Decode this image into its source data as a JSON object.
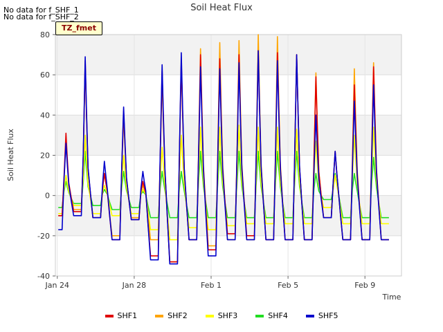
{
  "notes": [
    "No data for f_SHF_1",
    "No data for f_SHF_2"
  ],
  "tz_label": "TZ_fmet",
  "chart_data": {
    "type": "line",
    "title": "Soil Heat Flux",
    "xlabel": "Time",
    "ylabel": "Soil Heat Flux",
    "ylim": [
      -40,
      80
    ],
    "yticks": [
      -40,
      -20,
      0,
      20,
      40,
      60,
      80
    ],
    "xlim_days": [
      -0.1,
      17.9
    ],
    "xticks": [
      {
        "day": 0,
        "label": "Jan 24"
      },
      {
        "day": 4,
        "label": "Jan 28"
      },
      {
        "day": 8,
        "label": "Feb 1"
      },
      {
        "day": 12,
        "label": "Feb 5"
      },
      {
        "day": 16,
        "label": "Feb 9"
      }
    ],
    "grid": true,
    "legend_position": "bottom",
    "peaks_by_day": [
      {
        "day": 0,
        "SHF1": 31,
        "SHF2": 27,
        "SHF3": 10,
        "SHF4": 7,
        "SHF5": 26
      },
      {
        "day": 1,
        "SHF1": 67,
        "SHF2": 65,
        "SHF3": 30,
        "SHF4": 22,
        "SHF5": 69
      },
      {
        "day": 2,
        "SHF1": 11,
        "SHF2": 11,
        "SHF3": 5,
        "SHF4": 3,
        "SHF5": 17
      },
      {
        "day": 3,
        "SHF1": 42,
        "SHF2": 39,
        "SHF3": 20,
        "SHF4": 12,
        "SHF5": 44
      },
      {
        "day": 4,
        "SHF1": 7,
        "SHF2": 5,
        "SHF3": 3,
        "SHF4": 2,
        "SHF5": 12
      },
      {
        "day": 5,
        "SHF1": 62,
        "SHF2": 58,
        "SHF3": 24,
        "SHF4": 12,
        "SHF5": 65
      },
      {
        "day": 6,
        "SHF1": 67,
        "SHF2": 66,
        "SHF3": 30,
        "SHF4": 12,
        "SHF5": 71
      },
      {
        "day": 7,
        "SHF1": 70,
        "SHF2": 73,
        "SHF3": 34,
        "SHF4": 22,
        "SHF5": 64
      },
      {
        "day": 8,
        "SHF1": 68,
        "SHF2": 76,
        "SHF3": 34,
        "SHF4": 22,
        "SHF5": 63
      },
      {
        "day": 9,
        "SHF1": 70,
        "SHF2": 77,
        "SHF3": 35,
        "SHF4": 22,
        "SHF5": 66
      },
      {
        "day": 10,
        "SHF1": 72,
        "SHF2": 80,
        "SHF3": 34,
        "SHF4": 22,
        "SHF5": 72
      },
      {
        "day": 11,
        "SHF1": 71,
        "SHF2": 79,
        "SHF3": 34,
        "SHF4": 22,
        "SHF5": 67
      },
      {
        "day": 12,
        "SHF1": 70,
        "SHF2": 70,
        "SHF3": 33,
        "SHF4": 22,
        "SHF5": 70
      },
      {
        "day": 13,
        "SHF1": 59,
        "SHF2": 61,
        "SHF3": 27,
        "SHF4": 11,
        "SHF5": 40
      },
      {
        "day": 14,
        "SHF1": 22,
        "SHF2": 22,
        "SHF3": 10,
        "SHF4": 11,
        "SHF5": 22
      },
      {
        "day": 15,
        "SHF1": 55,
        "SHF2": 63,
        "SHF3": 30,
        "SHF4": 11,
        "SHF5": 47
      },
      {
        "day": 16,
        "SHF1": 64,
        "SHF2": 66,
        "SHF3": 34,
        "SHF4": 19,
        "SHF5": 55
      }
    ],
    "troughs_by_day": [
      {
        "day": 0,
        "SHF1": -10,
        "SHF2": -10,
        "SHF3": -9,
        "SHF4": -6,
        "SHF5": -17
      },
      {
        "day": 1,
        "SHF1": -8,
        "SHF2": -7,
        "SHF3": -5,
        "SHF4": -4,
        "SHF5": -10
      },
      {
        "day": 2,
        "SHF1": -11,
        "SHF2": -11,
        "SHF3": -9,
        "SHF4": -5,
        "SHF5": -11
      },
      {
        "day": 3,
        "SHF1": -22,
        "SHF2": -20,
        "SHF3": -10,
        "SHF4": -7,
        "SHF5": -22
      },
      {
        "day": 4,
        "SHF1": -12,
        "SHF2": -11,
        "SHF3": -9,
        "SHF4": -6,
        "SHF5": -12
      },
      {
        "day": 5,
        "SHF1": -30,
        "SHF2": -22,
        "SHF3": -17,
        "SHF4": -11,
        "SHF5": -32
      },
      {
        "day": 6,
        "SHF1": -33,
        "SHF2": -33,
        "SHF3": -22,
        "SHF4": -11,
        "SHF5": -34
      },
      {
        "day": 7,
        "SHF1": -22,
        "SHF2": -22,
        "SHF3": -16,
        "SHF4": -11,
        "SHF5": -22
      },
      {
        "day": 8,
        "SHF1": -27,
        "SHF2": -25,
        "SHF3": -17,
        "SHF4": -11,
        "SHF5": -30
      },
      {
        "day": 9,
        "SHF1": -19,
        "SHF2": -22,
        "SHF3": -15,
        "SHF4": -11,
        "SHF5": -22
      },
      {
        "day": 10,
        "SHF1": -20,
        "SHF2": -22,
        "SHF3": -14,
        "SHF4": -11,
        "SHF5": -22
      },
      {
        "day": 11,
        "SHF1": -22,
        "SHF2": -22,
        "SHF3": -14,
        "SHF4": -11,
        "SHF5": -22
      },
      {
        "day": 12,
        "SHF1": -22,
        "SHF2": -22,
        "SHF3": -14,
        "SHF4": -11,
        "SHF5": -22
      },
      {
        "day": 13,
        "SHF1": -22,
        "SHF2": -22,
        "SHF3": -14,
        "SHF4": -11,
        "SHF5": -22
      },
      {
        "day": 14,
        "SHF1": -11,
        "SHF2": -11,
        "SHF3": -6,
        "SHF4": -2,
        "SHF5": -11
      },
      {
        "day": 15,
        "SHF1": -22,
        "SHF2": -22,
        "SHF3": -14,
        "SHF4": -11,
        "SHF5": -22
      },
      {
        "day": 16,
        "SHF1": -22,
        "SHF2": -22,
        "SHF3": -14,
        "SHF4": -11,
        "SHF5": -22
      },
      {
        "day": 17,
        "SHF1": -22,
        "SHF2": -22,
        "SHF3": -14,
        "SHF4": -11,
        "SHF5": -22
      }
    ],
    "series": [
      {
        "name": "SHF1",
        "color": "#e00000"
      },
      {
        "name": "SHF2",
        "color": "#ffa500"
      },
      {
        "name": "SHF3",
        "color": "#ffff00"
      },
      {
        "name": "SHF4",
        "color": "#22dd22"
      },
      {
        "name": "SHF5",
        "color": "#0000cc"
      }
    ]
  }
}
